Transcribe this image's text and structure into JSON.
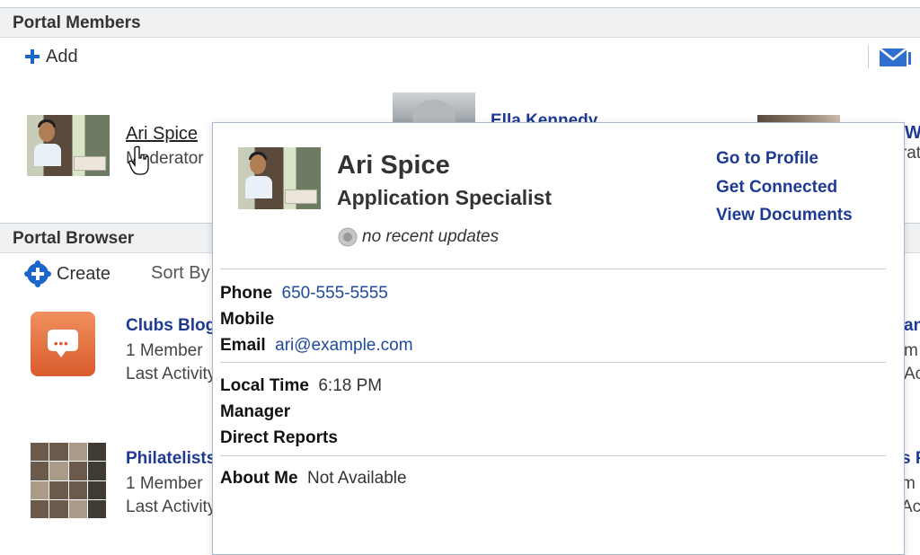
{
  "portal_members": {
    "title": "Portal Members",
    "add_label": "Add",
    "members": [
      {
        "name": "Ari Spice",
        "role": "Moderator"
      },
      {
        "name": "Ella Kennedy"
      },
      {
        "name": "Jen W",
        "role": "Operator"
      }
    ]
  },
  "portal_browser": {
    "title": "Portal Browser",
    "create_label": "Create",
    "sort_label": "Sort By",
    "portals": [
      {
        "name": "Clubs Blog",
        "members": "1 Member",
        "activity": "Last Activity"
      },
      {
        "name": "Philatelists",
        "members": "1 Member",
        "activity": "Last Activity"
      }
    ]
  },
  "right_clips": {
    "row1_lines": [
      "an",
      "m",
      "Ac"
    ],
    "row2_lines": [
      "s P",
      "m",
      "Ac"
    ]
  },
  "popup": {
    "name": "Ari Spice",
    "title": "Application Specialist",
    "status": "no recent updates",
    "actions": [
      "Go to Profile",
      "Get Connected",
      "View Documents"
    ],
    "contact": {
      "phone_label": "Phone",
      "phone_value": "650-555-5555",
      "mobile_label": "Mobile",
      "email_label": "Email",
      "email_value": "ari@example.com"
    },
    "work": {
      "local_time_label": "Local Time",
      "local_time_value": "6:18 PM",
      "manager_label": "Manager",
      "direct_reports_label": "Direct Reports"
    },
    "about": {
      "label": "About Me",
      "value": "Not Available"
    }
  },
  "colors": {
    "link": "#1f3a93",
    "accent_blue": "#1b66c9"
  },
  "icons": [
    "plus-icon",
    "mail-icon",
    "create-icon",
    "cursor-hand-icon",
    "status-icon"
  ]
}
